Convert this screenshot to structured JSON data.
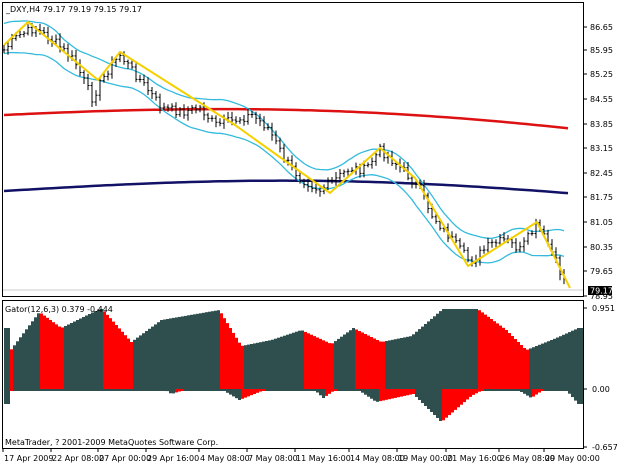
{
  "main_panel": {
    "symbol_line": "_DXY,H4  79.17 79.19 79.15 79.17",
    "current_price_tag": "79.17",
    "price_levels": [
      "86.65",
      "85.95",
      "85.25",
      "84.55",
      "83.85",
      "83.15",
      "82.45",
      "81.75",
      "81.05",
      "80.35",
      "79.65",
      "78.95"
    ]
  },
  "gator_panel": {
    "title": "Gator(12,6,3) 0.379 -0.444",
    "levels": [
      "0.951",
      "0.00",
      "-0.657"
    ],
    "watermark": "MetaTrader, ? 2001-2009 MetaQuotes Software Corp."
  },
  "time_axis": {
    "labels": [
      "17 Apr 2009",
      "22 Apr 08:00",
      "27 Apr 00:00",
      "29 Apr 16:00",
      "4 May 08:00",
      "7 May 08:00",
      "11 May 16:00",
      "14 May 08:00",
      "19 May 00:00",
      "21 May 16:00",
      "26 May 08:00",
      "29 May 00:00"
    ]
  },
  "colors": {
    "bollinger": "#33bbdd",
    "ma_red": "#dd1111",
    "ma_navy": "#111166",
    "zigzag": "#f5d000",
    "gator_up": "#ff0000",
    "gator_down": "#2f4f4f"
  }
}
